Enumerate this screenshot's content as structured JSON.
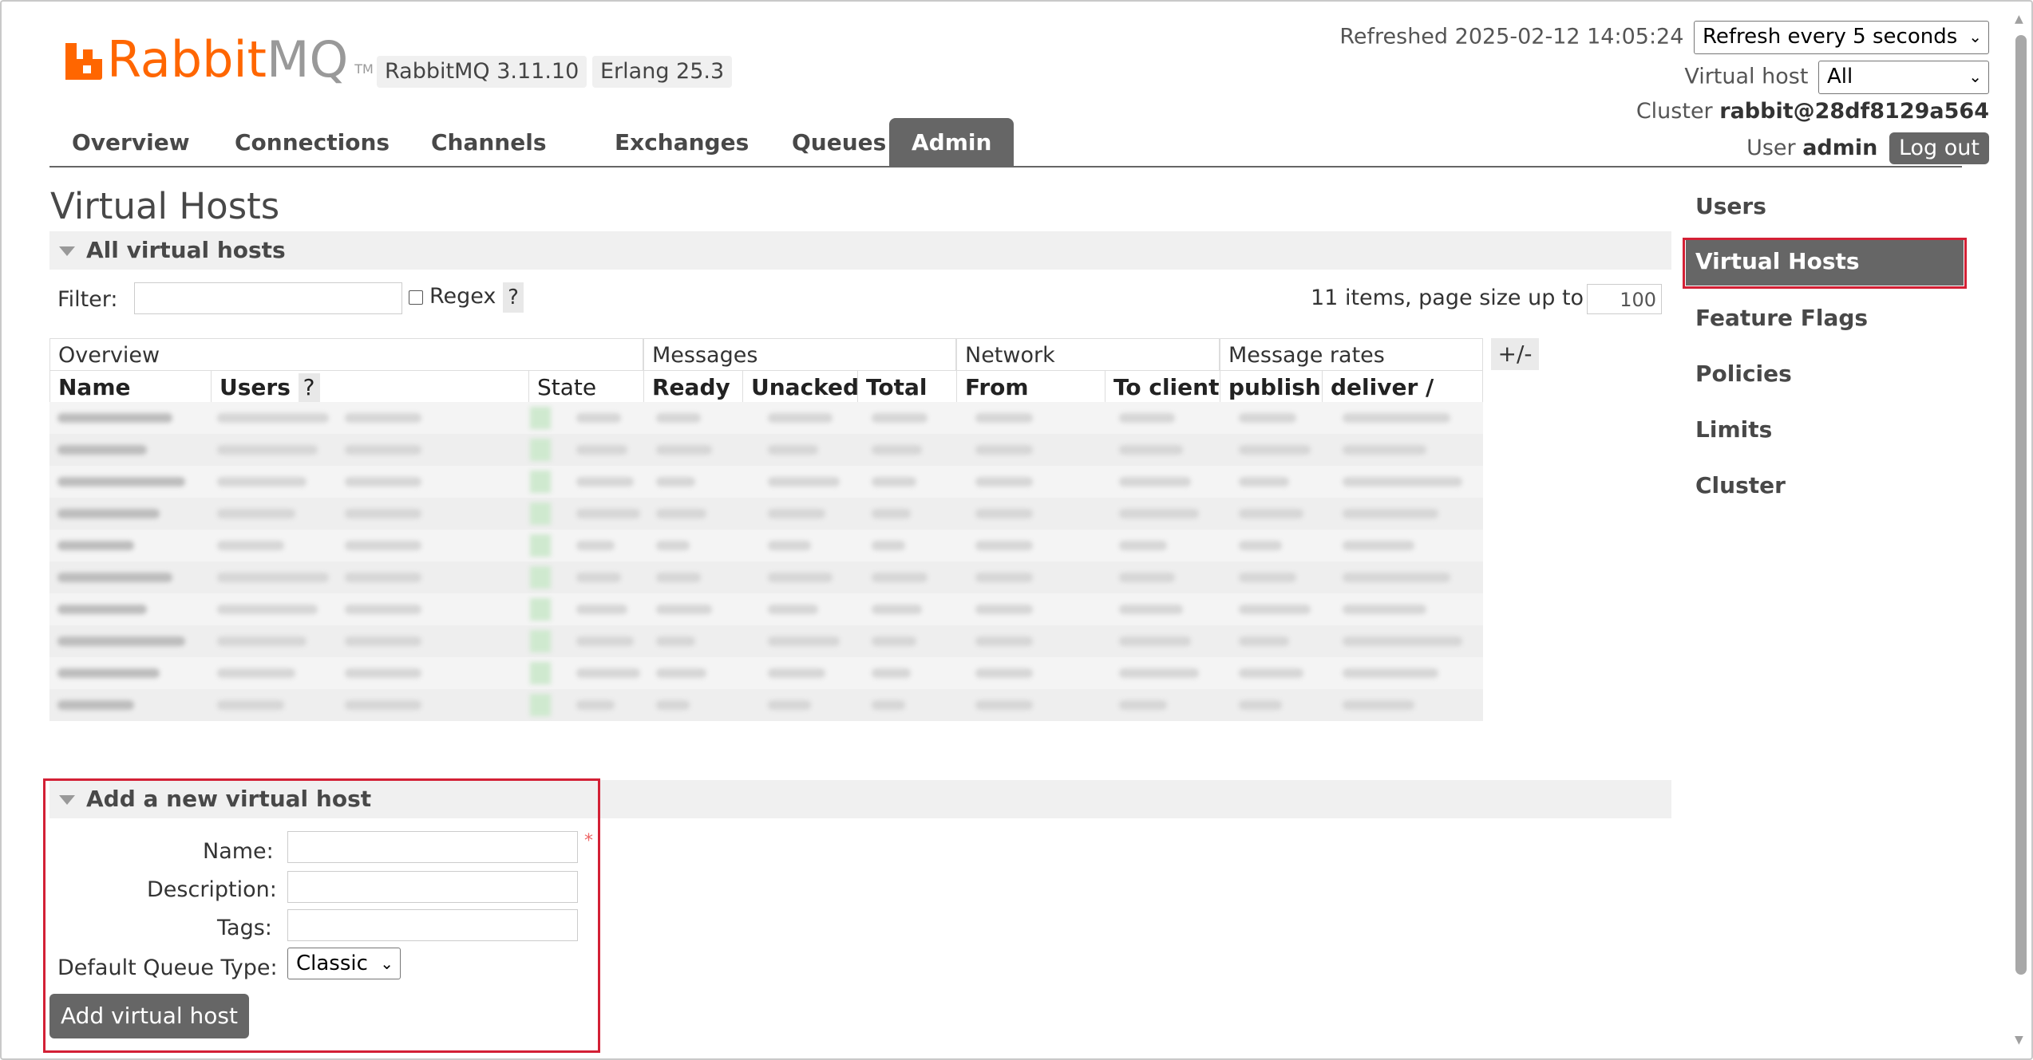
{
  "brand": {
    "name_part1": "Rabbit",
    "name_part2": "MQ",
    "tm": "TM"
  },
  "versions": {
    "rabbitmq": "RabbitMQ 3.11.10",
    "erlang": "Erlang 25.3"
  },
  "header": {
    "refreshed_label": "Refreshed 2025-02-12 14:05:24",
    "refresh_select": "Refresh every 5 seconds",
    "vhost_label": "Virtual host",
    "vhost_select": "All",
    "cluster_label": "Cluster",
    "cluster_name": "rabbit@28df8129a564",
    "user_label": "User",
    "user_name": "admin",
    "logout": "Log out"
  },
  "tabs": [
    "Overview",
    "Connections",
    "Channels",
    "Exchanges",
    "Queues",
    "Admin"
  ],
  "active_tab": "Admin",
  "page_title": "Virtual Hosts",
  "all_vhosts": {
    "section_title": "All virtual hosts",
    "filter_label": "Filter:",
    "regex_label": "Regex",
    "help": "?",
    "items_text": "11 items, page size up to",
    "page_size": "100"
  },
  "table": {
    "groups": [
      "Overview",
      "Messages",
      "Network",
      "Message rates"
    ],
    "columns": [
      "Name",
      "Users",
      "State",
      "Ready",
      "Unacked",
      "Total",
      "From client",
      "To client",
      "publish",
      "deliver / get"
    ],
    "users_help": "?",
    "toggle": "+/-",
    "row_count": 11
  },
  "add_vhost": {
    "section_title": "Add a new virtual host",
    "name_label": "Name:",
    "required_mark": "*",
    "description_label": "Description:",
    "tags_label": "Tags:",
    "queue_type_label": "Default Queue Type:",
    "queue_type_value": "Classic",
    "submit": "Add virtual host"
  },
  "sidebar": [
    "Users",
    "Virtual Hosts",
    "Feature Flags",
    "Policies",
    "Limits",
    "Cluster"
  ],
  "sidebar_active": "Virtual Hosts",
  "colors": {
    "brand_orange": "#ff6600",
    "tab_active": "#666666",
    "highlight_red": "#d32035"
  }
}
